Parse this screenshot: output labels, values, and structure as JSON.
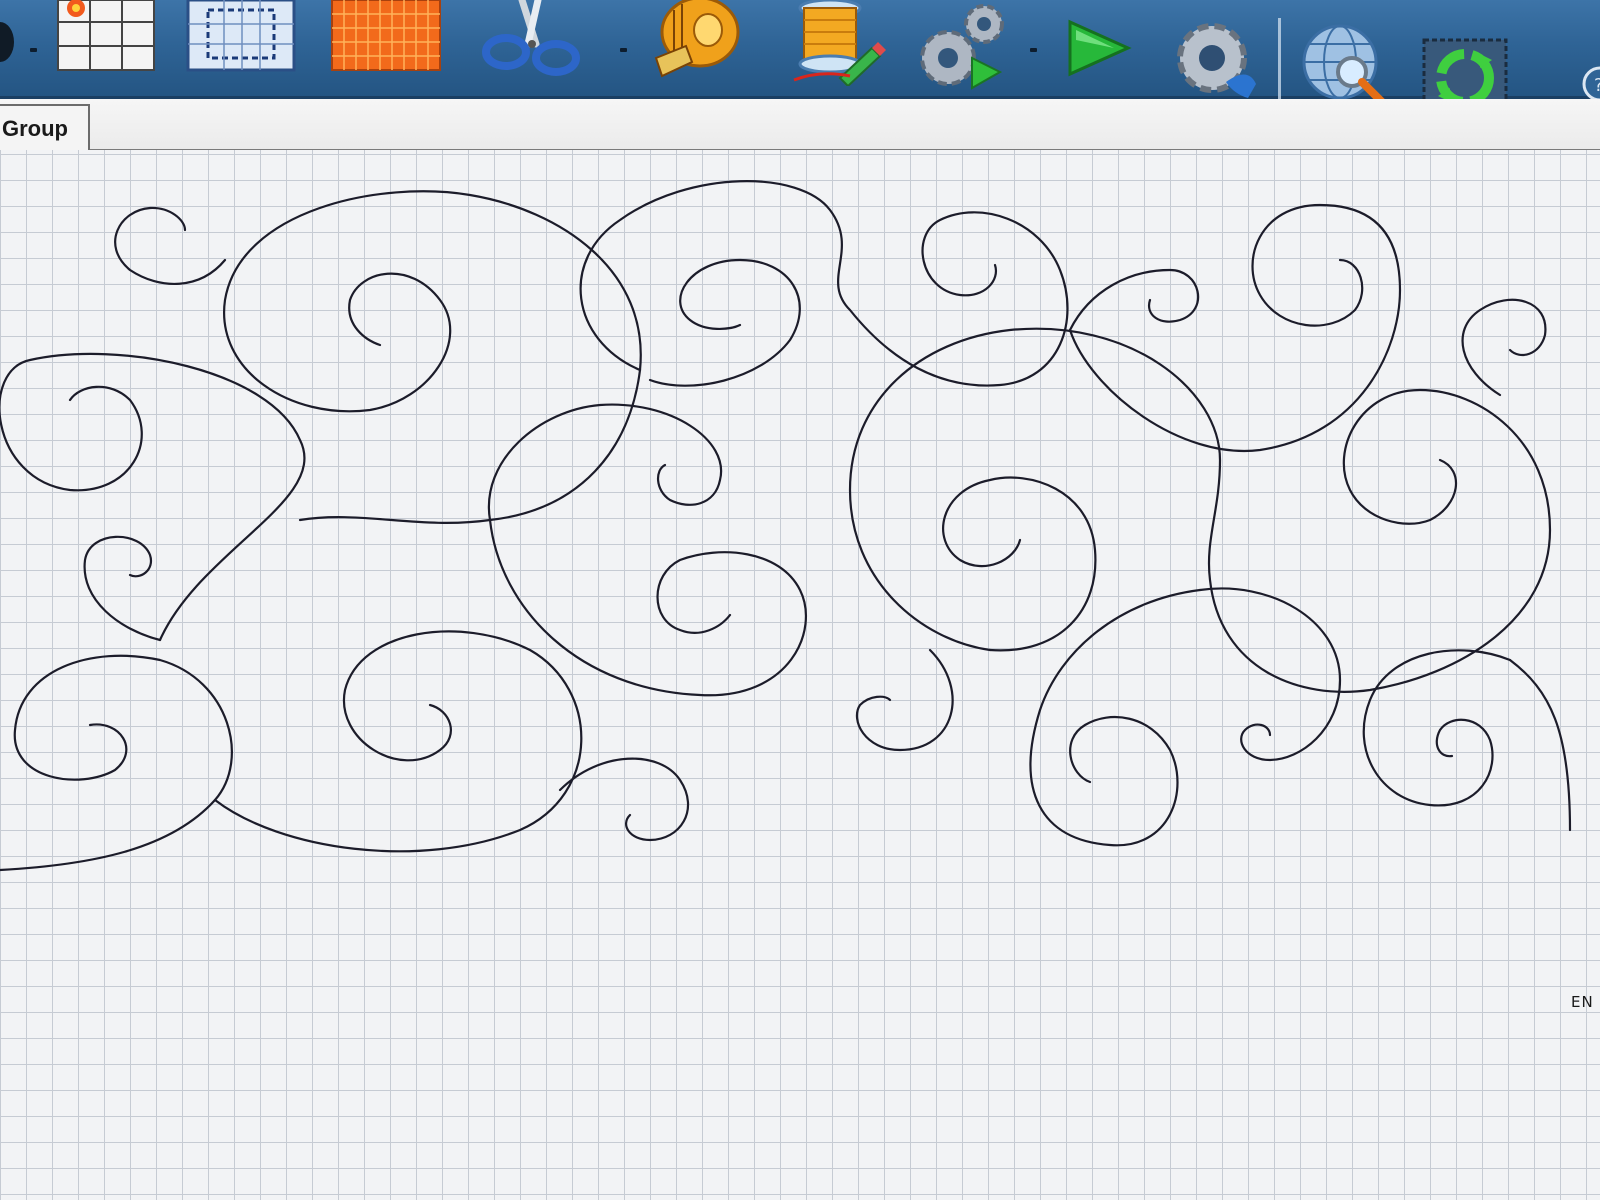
{
  "toolbar": {
    "buttons": [
      {
        "name": "quilt-block-grid-icon"
      },
      {
        "name": "dotted-grid-layout-icon"
      },
      {
        "name": "orange-grid-fill-icon"
      },
      {
        "name": "scissors-icon"
      },
      {
        "name": "measuring-tape-icon"
      },
      {
        "name": "thread-spool-edit-icon"
      },
      {
        "name": "gears-run-icon"
      },
      {
        "name": "play-icon"
      },
      {
        "name": "settings-gear-icon"
      },
      {
        "name": "globe-search-icon"
      },
      {
        "name": "recycle-refresh-icon"
      },
      {
        "name": "help-icon"
      }
    ],
    "colors": {
      "bar": "#2f6496",
      "bar_dark": "#245583"
    }
  },
  "tabs": [
    {
      "label": "Group",
      "active": true
    }
  ],
  "canvas": {
    "end_marker": "EN",
    "grid_color": "#c6cbd3",
    "stitch_color": "#1c1c2a"
  }
}
